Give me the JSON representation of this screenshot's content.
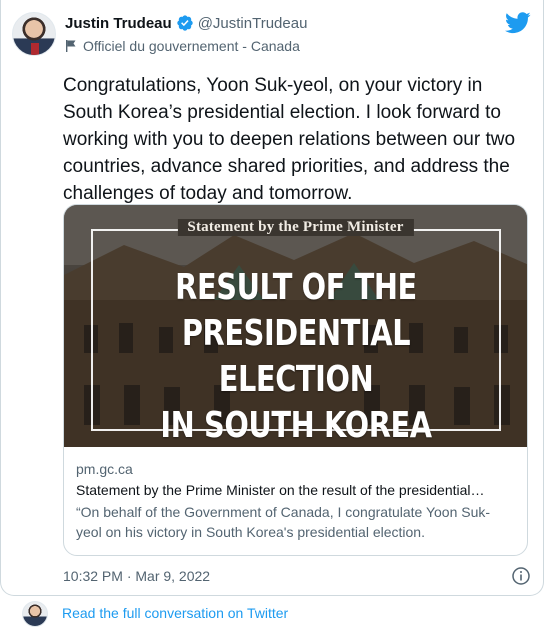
{
  "tweet": {
    "display_name": "Justin Trudeau",
    "handle": "@JustinTrudeau",
    "label": "Officiel du gouvernement - Canada",
    "text": "Congratulations, Yoon Suk-yeol, on your victory in South Korea’s presidential election. I look forward to working with you to deepen relations between our two countries, advance shared priorities, and address the challenges of today and tomorrow.",
    "timestamp": "10:32 PM · Mar 9, 2022"
  },
  "card": {
    "image_header": "Statement by the Prime Minister",
    "image_headline_lines": [
      "RESULT OF THE",
      "PRESIDENTIAL ELECTION",
      "IN SOUTH KOREA"
    ],
    "domain": "pm.gc.ca",
    "title": "Statement by the Prime Minister on the result of the presidential…",
    "description": "“On behalf of the Government of Canada, I congratulate Yoon Suk-yeol on his victory in South Korea's presidential election."
  },
  "footer": {
    "link_text": "Read the full conversation on Twitter"
  },
  "colors": {
    "accent": "#1d9bf0",
    "text_primary": "#0f1419",
    "text_secondary": "#536471",
    "border": "#cfd9de"
  },
  "icons": [
    "verified-badge-icon",
    "flag-icon",
    "twitter-bird-icon",
    "info-icon"
  ]
}
